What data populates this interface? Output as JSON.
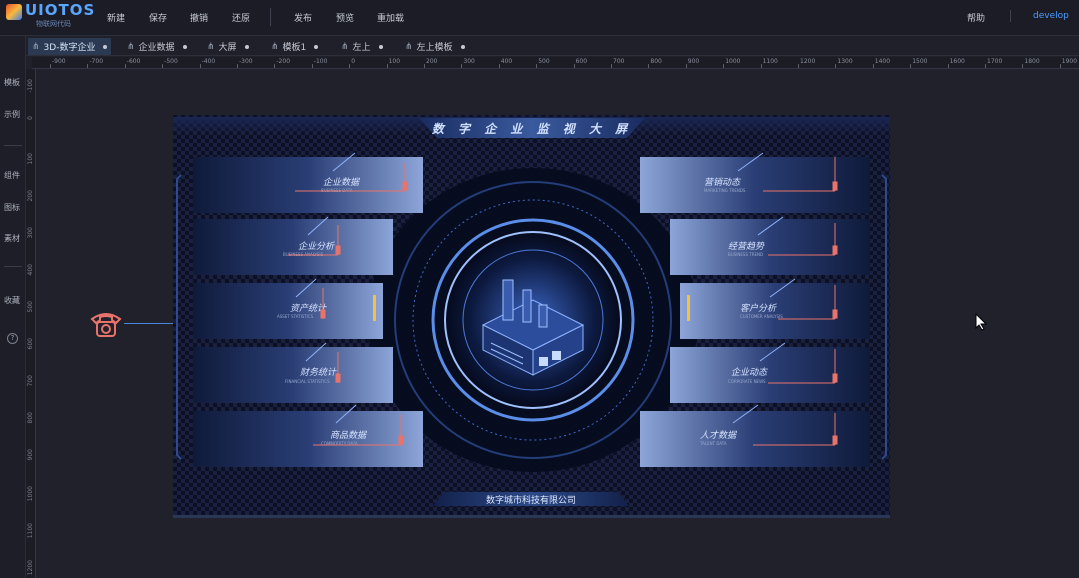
{
  "app": {
    "logo_text": "UIOTOS",
    "logo_sub": "物联网代码"
  },
  "menu": {
    "items": [
      "新建",
      "保存",
      "撤销",
      "还原",
      "发布",
      "预览",
      "重加载"
    ]
  },
  "header_right": {
    "help": "帮助",
    "user": "develop"
  },
  "tabs": {
    "side_label": "文件",
    "items": [
      "3D-数字企业",
      "企业数据",
      "大屏",
      "模板1",
      "左上",
      "左上模板"
    ]
  },
  "sidebar": {
    "items": [
      "模板",
      "示例",
      "组件",
      "图标",
      "素材",
      "收藏"
    ],
    "help_icon": "?"
  },
  "ruler": {
    "labels": [
      "-900",
      "-700",
      "-600",
      "-500",
      "-400",
      "-300",
      "-200",
      "-100",
      "0",
      "100",
      "200",
      "300",
      "400",
      "500",
      "600",
      "700",
      "800",
      "900",
      "1000",
      "1100",
      "1200",
      "1300",
      "1400",
      "1500",
      "1600",
      "1700",
      "1800",
      "1900"
    ]
  },
  "vruler": {
    "labels": [
      "-100",
      "0",
      "100",
      "200",
      "300",
      "400",
      "500",
      "600",
      "700",
      "800",
      "900",
      "1000",
      "1100",
      "1200"
    ]
  },
  "screen": {
    "title": "数 字 企 业 监 视 大 屏",
    "footer": "数字城市科技有限公司",
    "left_panels": [
      {
        "label": "企业数据",
        "sub": "BUSINESS DATA"
      },
      {
        "label": "企业分析",
        "sub": "BUSINESS ANALYSIS"
      },
      {
        "label": "资产统计",
        "sub": "ASSET STATISTICS"
      },
      {
        "label": "财务统计",
        "sub": "FINANCIAL STATISTICS"
      },
      {
        "label": "商品数据",
        "sub": "COMMODITY DATA"
      }
    ],
    "right_panels": [
      {
        "label": "营销动态",
        "sub": "MARKETING TRENDS"
      },
      {
        "label": "经营趋势",
        "sub": "BUSINESS TREND"
      },
      {
        "label": "客户分析",
        "sub": "CUSTOMER ANALYSIS"
      },
      {
        "label": "企业动态",
        "sub": "CORPORATE NEWS"
      },
      {
        "label": "人才数据",
        "sub": "TALENT DATA"
      }
    ]
  },
  "colors": {
    "accent": "#3d8bff",
    "background": "#20212b",
    "glow": "#5aa6ff",
    "alert": "#e8736a"
  }
}
